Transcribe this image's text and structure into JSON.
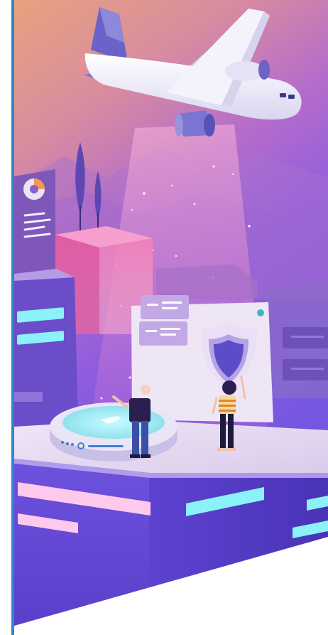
{
  "illustration": {
    "subject": "isometric-airport-security-scene",
    "icons": [
      "airplane-icon",
      "shield-icon",
      "donut-chart-icon",
      "menu-lines-icon"
    ],
    "colors": {
      "sky_top": "#E7A07F",
      "sky_mid": "#C06BC0",
      "sky_bottom": "#7F5CE0",
      "platform_top": "#E9DDF1",
      "platform_front": "#6B4BD4",
      "platform_side": "#4E36B8",
      "neon_cyan": "#7FF1F6",
      "neon_pink": "#FFC9EC",
      "left_border": "#2F86C8",
      "shield": "#5B4DC8"
    }
  }
}
